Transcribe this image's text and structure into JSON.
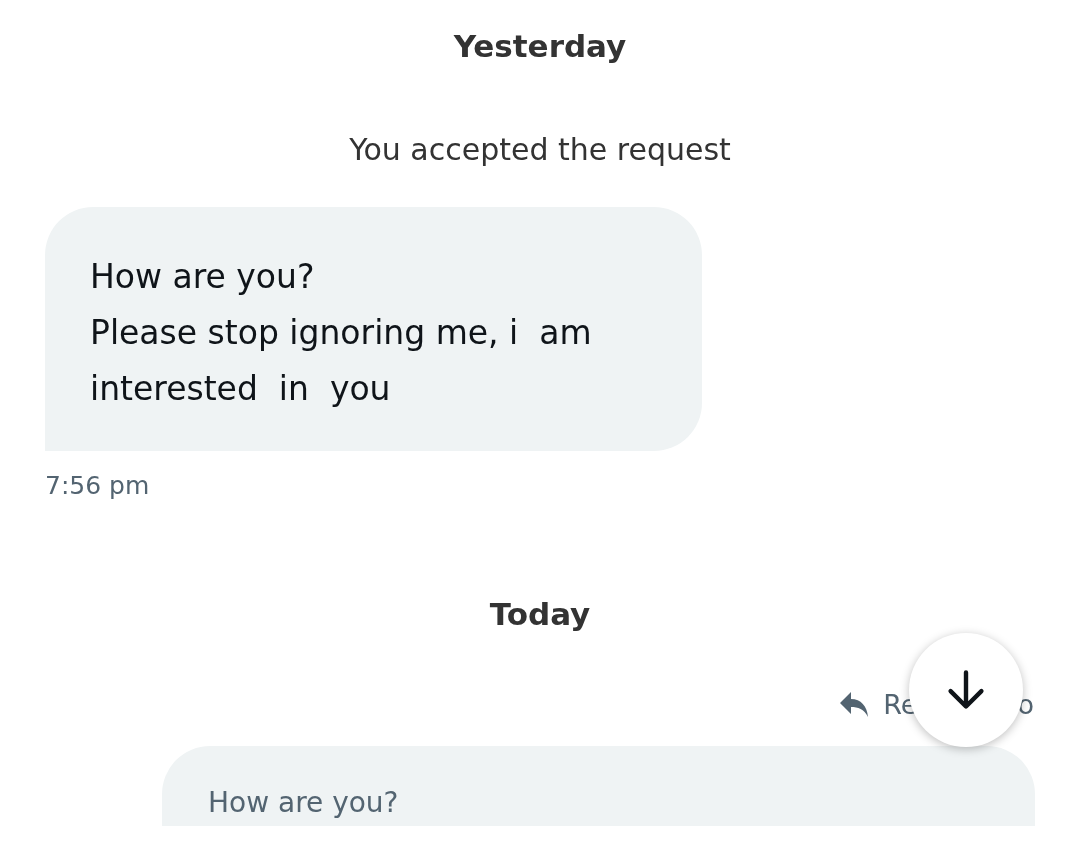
{
  "days": [
    {
      "label": "Yesterday"
    }
  ],
  "notice": "You accepted the request",
  "message": {
    "lines": [
      "How are you?",
      "Please stop ignoring me, i  am",
      "interested  in  you"
    ],
    "time": "7:56 pm"
  },
  "today": "Today",
  "reply": {
    "label_start": "Re",
    "label_end": "o",
    "quoted": "How are you?"
  }
}
